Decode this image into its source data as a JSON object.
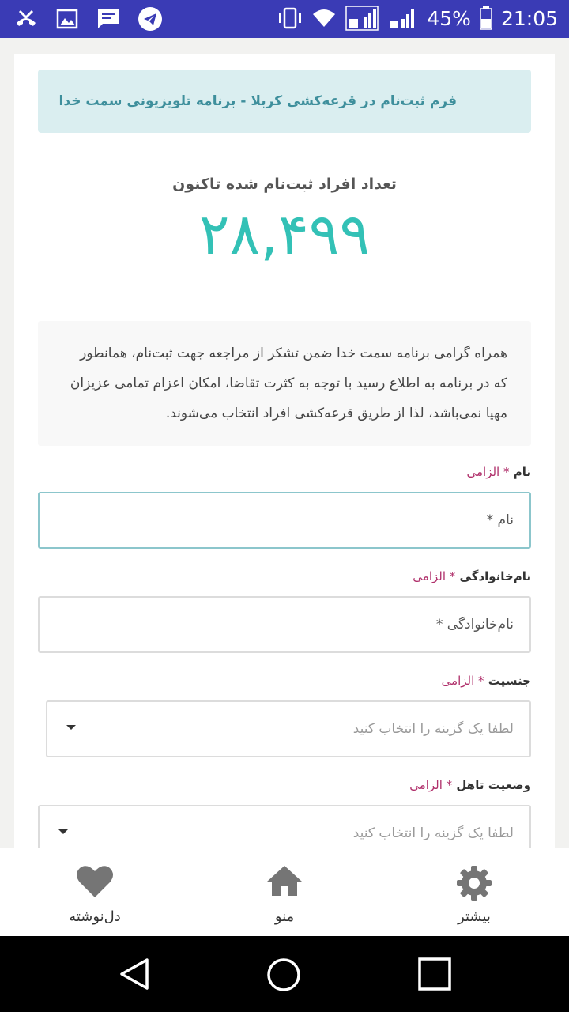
{
  "status_bar": {
    "battery_percent": "45%",
    "time": "21:05",
    "icons_left": [
      "missed-call-icon",
      "image-icon",
      "message-icon",
      "telegram-icon"
    ],
    "icons_right": [
      "vibrate-icon",
      "wifi-icon",
      "signal-icon",
      "signal-icon",
      "battery-icon"
    ]
  },
  "header": {
    "banner": "فرم ثبت‌نام در قرعه‌کشی کربلا - برنامه تلویزیونی سمت خدا"
  },
  "counter": {
    "label": "تعداد افراد ثبت‌نام شده تاکنون",
    "value": "۲۸,۴۹۹"
  },
  "notice": {
    "text": "همراه گرامی برنامه سمت خدا ضمن تشکر از مراجعه جهت ثبت‌نام، همانطور که در برنامه به اطلاع رسید با توجه به کثرت تقاضا، امکان اعزام تمامی عزیزان مهیا نمی‌باشد، لذا از طریق قرعه‌کشی افراد انتخاب می‌شوند."
  },
  "form": {
    "required_marker": "* الزامی",
    "first_name": {
      "label": "نام",
      "placeholder": "نام *"
    },
    "last_name": {
      "label": "نام‌خانوادگی",
      "placeholder": "نام‌خانوادگی *"
    },
    "gender": {
      "label": "جنسیت",
      "placeholder": "لطفا یک گزینه را انتخاب کنید"
    },
    "marital": {
      "label": "وضعیت تاهل",
      "placeholder": "لطفا یک گزینه را انتخاب کنید"
    }
  },
  "bottom_nav": {
    "favorites": "دل‌نوشته",
    "menu": "منو",
    "more": "بیشتر"
  },
  "colors": {
    "status_bar": "#3a3bb5",
    "accent": "#33c1b6",
    "banner_bg": "#daeef0",
    "required": "#b0306b"
  }
}
